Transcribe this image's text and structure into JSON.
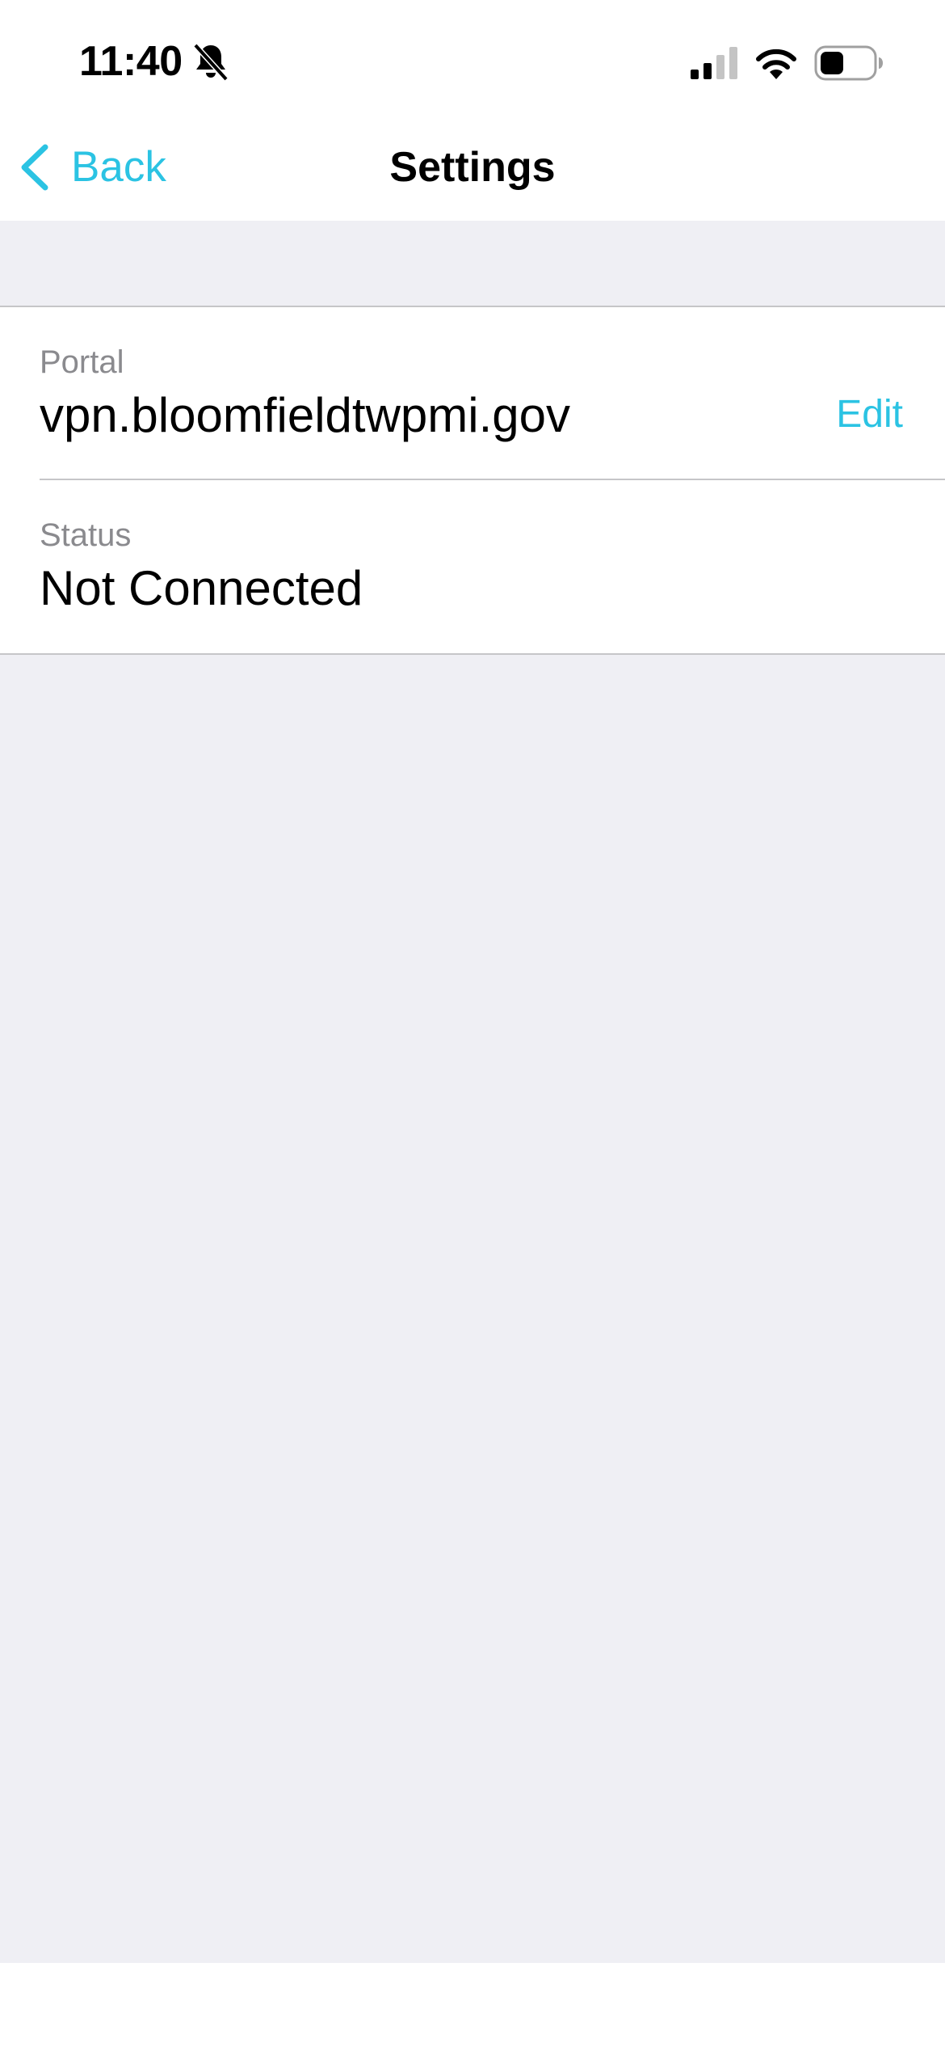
{
  "status_bar": {
    "time": "11:40",
    "icons": [
      "bell-slash-icon",
      "signal-icon",
      "wifi-icon",
      "battery-icon"
    ]
  },
  "nav": {
    "back_label": "Back",
    "title": "Settings"
  },
  "settings": {
    "portal": {
      "caption": "Portal",
      "value": "vpn.bloomfieldtwpmi.gov",
      "edit_label": "Edit"
    },
    "status": {
      "caption": "Status",
      "value": "Not Connected"
    }
  },
  "colors": {
    "accent": "#2bc3e3",
    "grouped_background": "#efeff4",
    "separator": "#c6c6c8",
    "secondary_text": "#8a8a8e"
  }
}
